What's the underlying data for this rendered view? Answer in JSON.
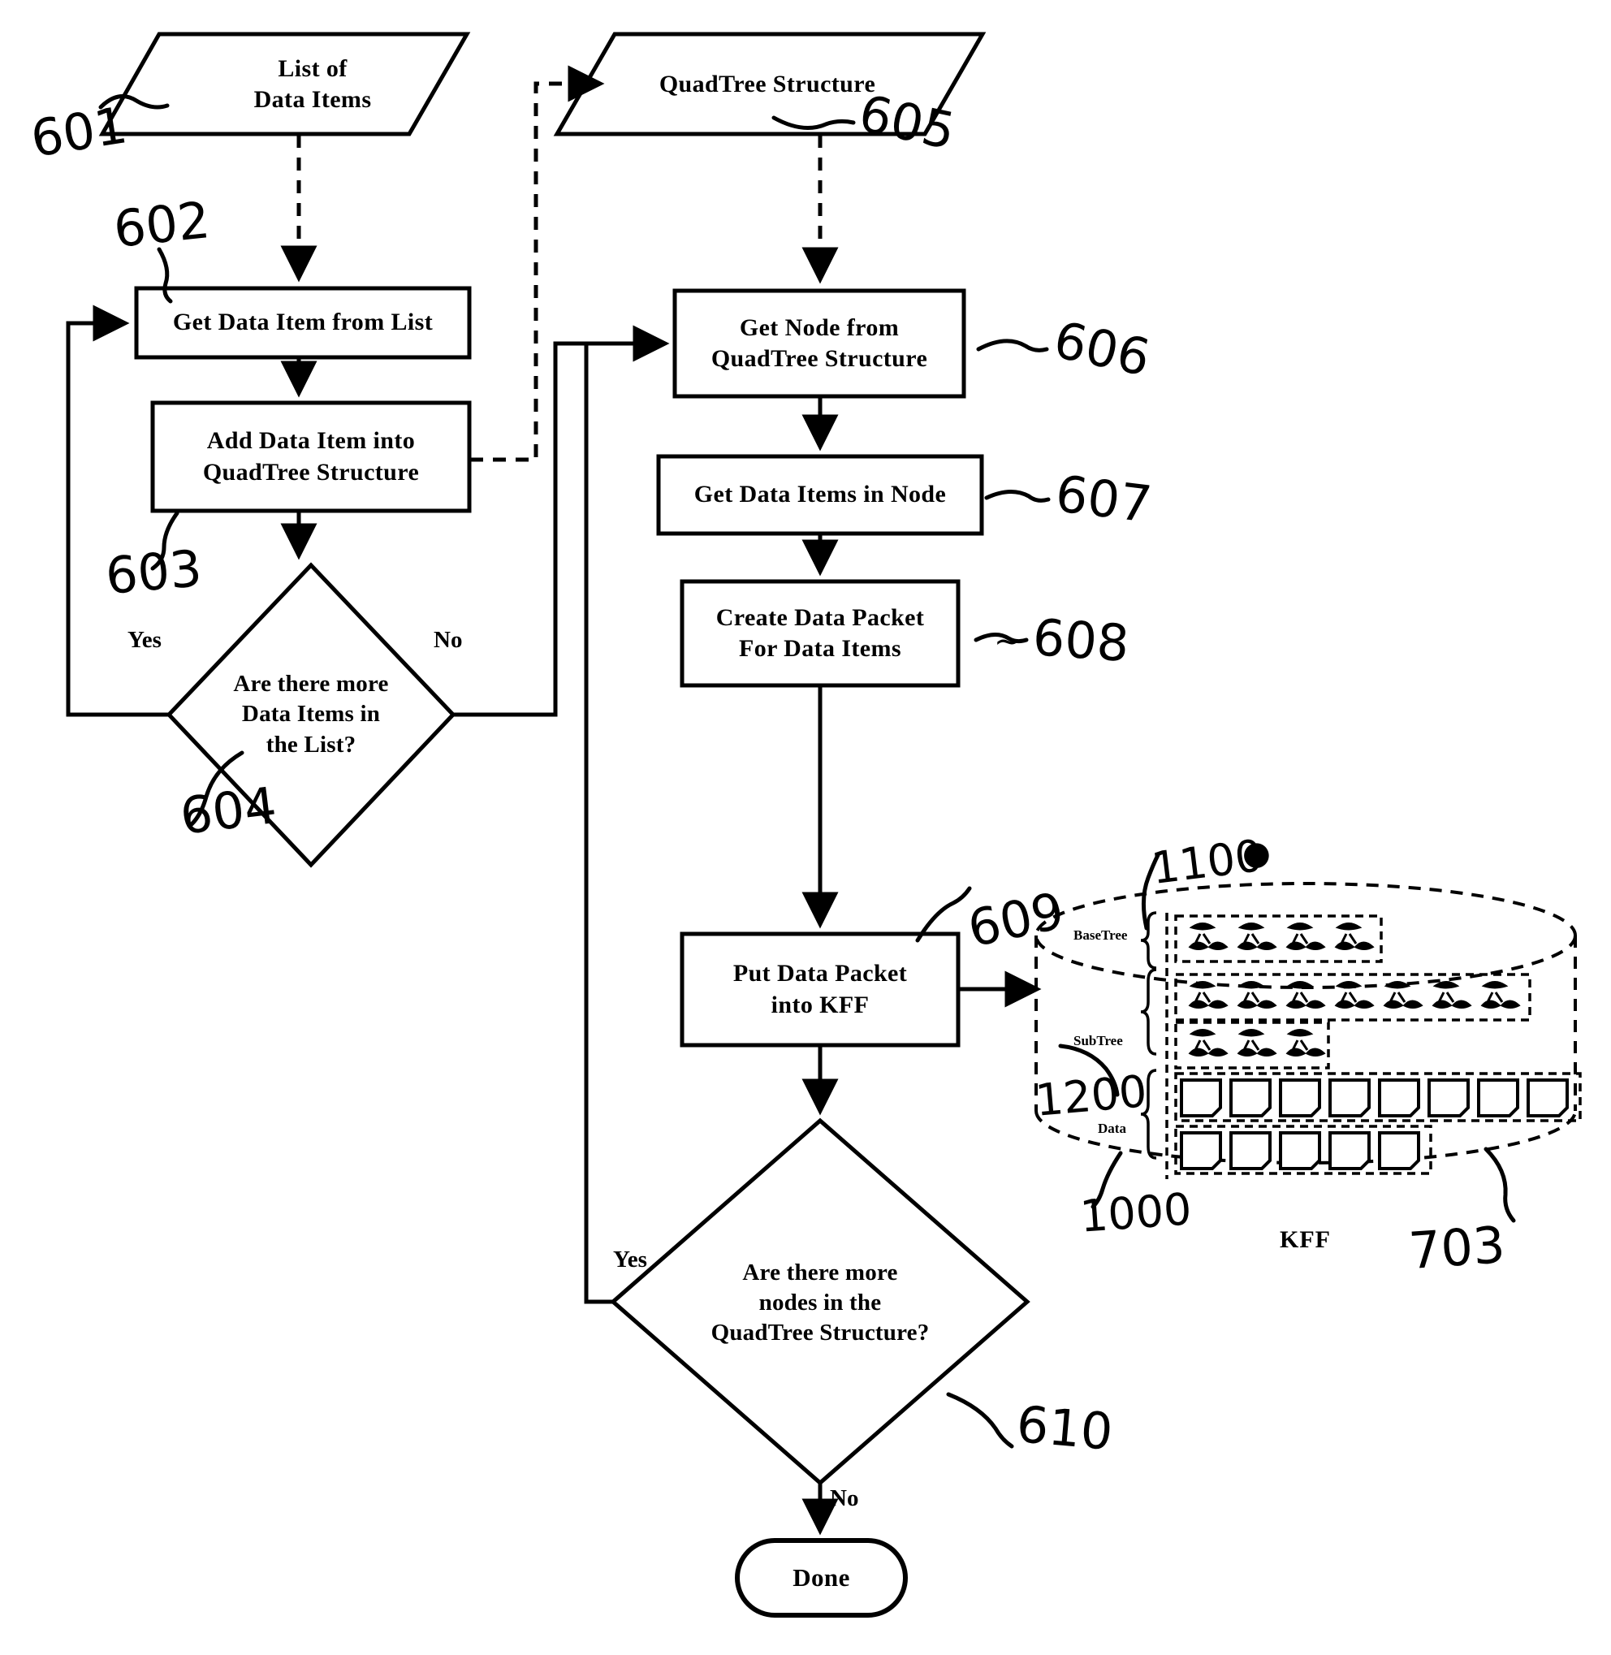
{
  "figure": {
    "type": "patent-flowchart",
    "nodes": [
      {
        "id": "601",
        "shape": "parallelogram",
        "label": "List of\nData Items",
        "ref": "601"
      },
      {
        "id": "602",
        "shape": "process",
        "label": "Get Data Item from List",
        "ref": "602"
      },
      {
        "id": "603",
        "shape": "process",
        "label": "Add Data Item into\nQuadTree Structure",
        "ref": "603"
      },
      {
        "id": "604",
        "shape": "decision",
        "label": "Are there more\nData Items in\nthe List?",
        "ref": "604",
        "yes": "Yes",
        "no": "No"
      },
      {
        "id": "605",
        "shape": "parallelogram",
        "label": "QuadTree Structure",
        "ref": "605"
      },
      {
        "id": "606",
        "shape": "process",
        "label": "Get Node from\nQuadTree Structure",
        "ref": "606"
      },
      {
        "id": "607",
        "shape": "process",
        "label": "Get Data Items  in Node",
        "ref": "607"
      },
      {
        "id": "608",
        "shape": "process",
        "label": "Create Data Packet\nFor Data Items",
        "ref": "608"
      },
      {
        "id": "609",
        "shape": "process",
        "label": "Put Data Packet\ninto KFF",
        "ref": "609"
      },
      {
        "id": "610",
        "shape": "decision",
        "label": "Are there more\nnodes in the\nQuadTree Structure?",
        "ref": "610",
        "yes": "Yes",
        "no": "No"
      },
      {
        "id": "done",
        "shape": "terminator",
        "label": "Done"
      }
    ],
    "edge_labels": {
      "yes_604": "Yes",
      "no_604": "No",
      "yes_610": "Yes",
      "no_610": "No"
    },
    "reference_numerals": [
      "601",
      "602",
      "603",
      "604",
      "605",
      "606",
      "607",
      "608",
      "609",
      "610",
      "1100",
      "1200",
      "1000",
      "703"
    ]
  },
  "kff": {
    "caption": "KFF",
    "ref_store": "703",
    "ref_basetree": "1100",
    "ref_subtree": "1200",
    "ref_data": "1000",
    "sections": [
      {
        "name": "BaseTree",
        "label": "BaseTree",
        "rows": [
          {
            "cells": 4
          }
        ]
      },
      {
        "name": "SubTree",
        "label": "SubTree",
        "rows": [
          {
            "cells": 7
          },
          {
            "cells": 3
          }
        ]
      },
      {
        "name": "Data",
        "label": "Data",
        "rows": [
          {
            "cells": 8
          },
          {
            "cells": 5
          }
        ]
      }
    ]
  },
  "colors": {
    "ink": "#000000",
    "background": "#ffffff"
  }
}
